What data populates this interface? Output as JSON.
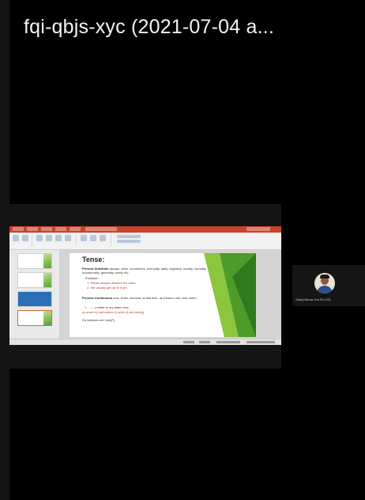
{
  "meeting": {
    "title": "fqi-qbjs-xyc (2021-07-04 a..."
  },
  "slide": {
    "title": "Tense:",
    "bullet1_heading": "Present Indefinite",
    "bullet1_text": "always, often, sometimes, everyday, daily, regularly, usually, normally, occasionally, generally, rarely etc.",
    "bullet1_example": "Example:",
    "bullet1_item1": "1. Rahim always disturbs the class.",
    "bullet1_item2": "2. We usually get up at 6 am.",
    "bullet2_heading": "Present Continuous",
    "bullet2_text": "now, at the moment, at this time, at present, still, look, listen.",
    "bullet2_line1": "I ........ a letter to my sister now.",
    "bullet2_line2": "a) wrote b) had written c) write d) am writing",
    "bullet2_line3": "He believes me now(F)"
  },
  "participant": {
    "name": "Sabuj Barua (Yoi Fia 2/3)"
  },
  "colors": {
    "background": "#000000",
    "ribbon_accent": "#c8432b",
    "slide_green": "#4f9b2a"
  }
}
